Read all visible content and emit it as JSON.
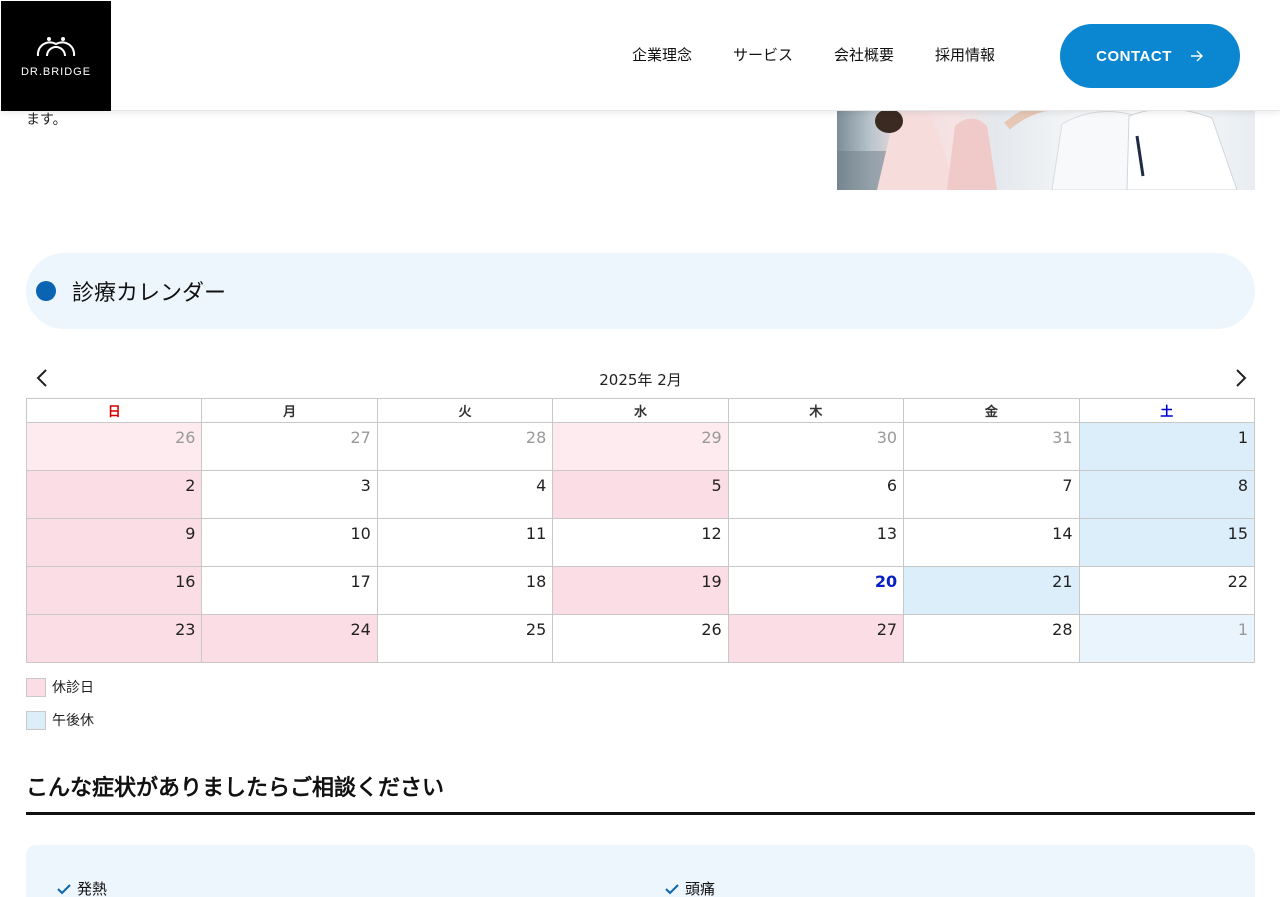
{
  "header": {
    "logo_text": "DR.BRIDGE",
    "nav": [
      "企業理念",
      "サービス",
      "会社概要",
      "採用情報"
    ],
    "contact_label": "CONTACT"
  },
  "intro": {
    "text_fragment": "ます。"
  },
  "section": {
    "title": "診療カレンダー"
  },
  "calendar": {
    "title": "2025年 2月",
    "weekdays": [
      "日",
      "月",
      "火",
      "水",
      "木",
      "金",
      "土"
    ],
    "weeks": [
      [
        {
          "d": "26",
          "s": "closed",
          "o": true
        },
        {
          "d": "27",
          "s": "",
          "o": true
        },
        {
          "d": "28",
          "s": "",
          "o": true
        },
        {
          "d": "29",
          "s": "closed",
          "o": true
        },
        {
          "d": "30",
          "s": "",
          "o": true
        },
        {
          "d": "31",
          "s": "",
          "o": true
        },
        {
          "d": "1",
          "s": "pm",
          "o": false
        }
      ],
      [
        {
          "d": "2",
          "s": "closed",
          "o": false
        },
        {
          "d": "3",
          "s": "",
          "o": false
        },
        {
          "d": "4",
          "s": "",
          "o": false
        },
        {
          "d": "5",
          "s": "closed",
          "o": false
        },
        {
          "d": "6",
          "s": "",
          "o": false
        },
        {
          "d": "7",
          "s": "",
          "o": false
        },
        {
          "d": "8",
          "s": "pm",
          "o": false
        }
      ],
      [
        {
          "d": "9",
          "s": "closed",
          "o": false
        },
        {
          "d": "10",
          "s": "",
          "o": false
        },
        {
          "d": "11",
          "s": "",
          "o": false
        },
        {
          "d": "12",
          "s": "",
          "o": false
        },
        {
          "d": "13",
          "s": "",
          "o": false
        },
        {
          "d": "14",
          "s": "",
          "o": false
        },
        {
          "d": "15",
          "s": "pm",
          "o": false
        }
      ],
      [
        {
          "d": "16",
          "s": "closed",
          "o": false
        },
        {
          "d": "17",
          "s": "",
          "o": false
        },
        {
          "d": "18",
          "s": "",
          "o": false
        },
        {
          "d": "19",
          "s": "closed",
          "o": false
        },
        {
          "d": "20",
          "s": "today",
          "o": false
        },
        {
          "d": "21",
          "s": "pm",
          "o": false
        },
        {
          "d": "22",
          "s": "",
          "o": false
        }
      ],
      [
        {
          "d": "23",
          "s": "closed",
          "o": false
        },
        {
          "d": "24",
          "s": "closed",
          "o": false
        },
        {
          "d": "25",
          "s": "",
          "o": false
        },
        {
          "d": "26",
          "s": "",
          "o": false
        },
        {
          "d": "27",
          "s": "closed",
          "o": false
        },
        {
          "d": "28",
          "s": "",
          "o": false
        },
        {
          "d": "1",
          "s": "pm",
          "o": true
        }
      ]
    ]
  },
  "legend": [
    {
      "label": "休診日",
      "color": "#fbdde6"
    },
    {
      "label": "午後休",
      "color": "#ddeefb"
    }
  ],
  "symptoms": {
    "title": "こんな症状がありましたらご相談ください",
    "items": [
      "発熱",
      "頭痛"
    ]
  },
  "colors": {
    "accent": "#0a87d0",
    "dot": "#0a64b2",
    "closed": "#fbdde6",
    "afternoon_off": "#ddeefb"
  }
}
